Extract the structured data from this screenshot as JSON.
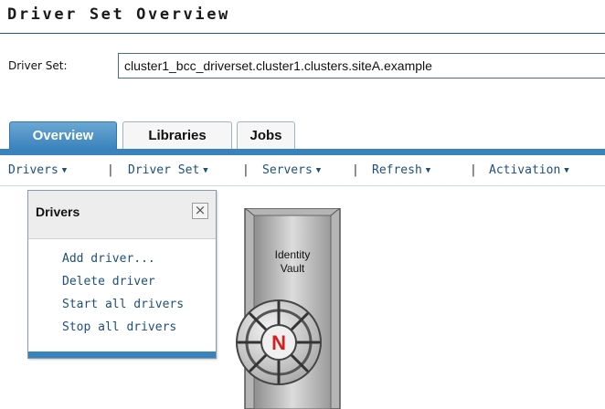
{
  "page": {
    "title": "Driver Set Overview"
  },
  "driver_set": {
    "label": "Driver Set:",
    "value": "cluster1_bcc_driverset.cluster1.clusters.siteA.example"
  },
  "tabs": [
    {
      "label": "Overview",
      "active": true
    },
    {
      "label": "Libraries",
      "active": false
    },
    {
      "label": "Jobs",
      "active": false
    }
  ],
  "menubar": {
    "items": [
      {
        "label": "Drivers",
        "icon": "caret-down-icon"
      },
      {
        "label": "Driver Set",
        "icon": "caret-down-icon"
      },
      {
        "label": "Servers",
        "icon": "caret-down-icon"
      },
      {
        "label": "Refresh",
        "icon": "caret-down-icon"
      },
      {
        "label": "Activation",
        "icon": "caret-down-icon"
      }
    ],
    "separator": "|"
  },
  "drivers_popup": {
    "title": "Drivers",
    "close_icon": "close-icon",
    "items": [
      "Add driver...",
      "Delete driver",
      "Start all drivers",
      "Stop all drivers"
    ]
  },
  "vault": {
    "label_line1": "Identity",
    "label_line2": "Vault",
    "logo_letter": "N"
  },
  "colors": {
    "accent": "#3a82bc",
    "link": "#1d4f7c",
    "logo_red": "#d42020"
  }
}
